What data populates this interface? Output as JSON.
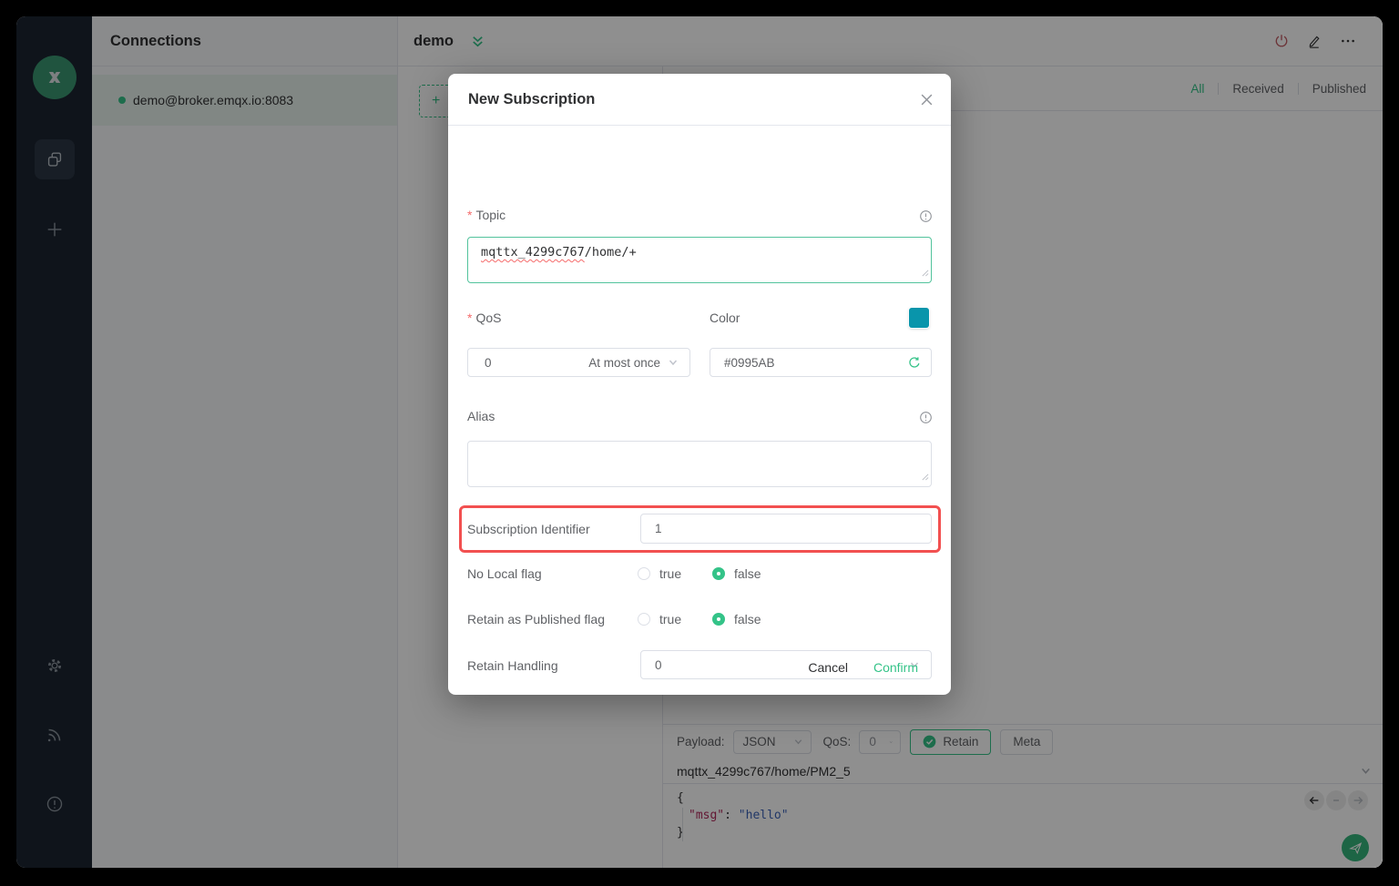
{
  "colors": {
    "accent": "#34c388",
    "subscription_color": "#0995AB",
    "highlight_box": "#f25050",
    "disconnect_icon": "#f56c6c"
  },
  "connections_panel": {
    "title": "Connections",
    "items": [
      {
        "label": "demo@broker.emqx.io:8083",
        "status": "connected"
      }
    ]
  },
  "header": {
    "title": "demo"
  },
  "messages_toolbar": {
    "tabs": [
      {
        "label": "All",
        "active": true
      },
      {
        "label": "Received",
        "active": false
      },
      {
        "label": "Published",
        "active": false
      }
    ]
  },
  "subscriptions_panel": {
    "new_button_label": "+"
  },
  "modal": {
    "title": "New Subscription",
    "topic": {
      "label": "Topic",
      "required": true,
      "value": "mqttx_4299c767/home/+",
      "value_main": "mqttx_4299c767",
      "value_rest": "/home/+"
    },
    "qos": {
      "label": "QoS",
      "required": true,
      "value": "0",
      "value_text": "At most once"
    },
    "color": {
      "label": "Color",
      "value": "#0995AB"
    },
    "alias": {
      "label": "Alias",
      "value": ""
    },
    "subscription_identifier": {
      "label": "Subscription Identifier",
      "value": "1"
    },
    "no_local": {
      "label": "No Local flag",
      "options": [
        "true",
        "false"
      ],
      "selected": "false"
    },
    "retain_as_published": {
      "label": "Retain as Published flag",
      "options": [
        "true",
        "false"
      ],
      "selected": "false"
    },
    "retain_handling": {
      "label": "Retain Handling",
      "value": "0"
    },
    "cancel_label": "Cancel",
    "confirm_label": "Confirm"
  },
  "composer": {
    "payload_label": "Payload:",
    "payload_format": "JSON",
    "qos_label": "QoS:",
    "qos_value": "0",
    "retain_label": "Retain",
    "meta_label": "Meta",
    "topic": "mqttx_4299c767/home/PM2_5",
    "payload": {
      "line_open": "{",
      "key": "\"msg\"",
      "separator": ": ",
      "value": "\"hello\"",
      "line_close": "}"
    }
  }
}
